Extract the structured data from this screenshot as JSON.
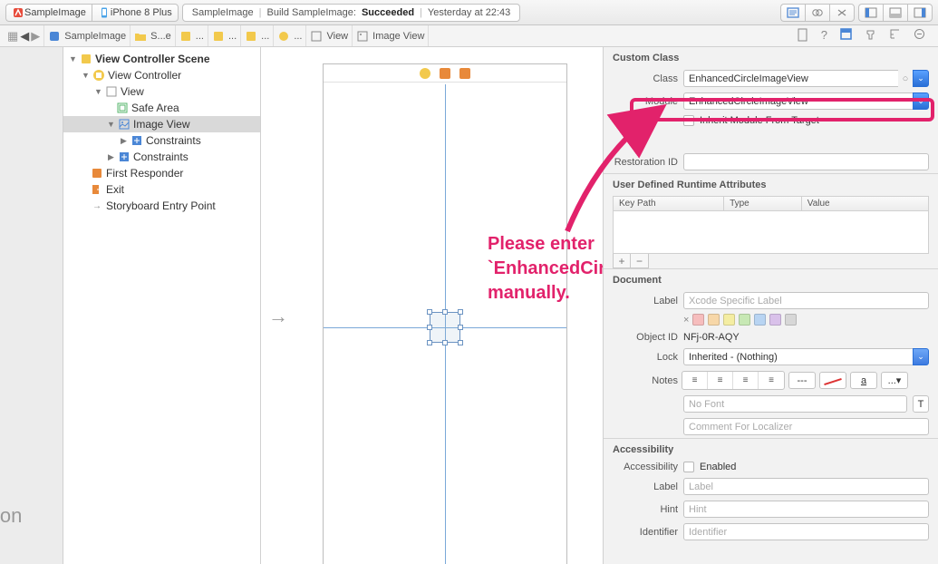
{
  "toolbar": {
    "scheme_project": "SampleImage",
    "scheme_device": "iPhone 8 Plus",
    "status_project": "SampleImage",
    "status_action": "Build SampleImage:",
    "status_result": "Succeeded",
    "status_time": "Yesterday at 22:43"
  },
  "jumpbar": {
    "segs": [
      "SampleImage",
      "S...e",
      "...",
      "...",
      "...",
      "...",
      "View",
      "Image View"
    ]
  },
  "outline": {
    "scene": "View Controller Scene",
    "vc": "View Controller",
    "view": "View",
    "safe": "Safe Area",
    "imgview": "Image View",
    "constraints1": "Constraints",
    "constraints2": "Constraints",
    "first_responder": "First Responder",
    "exit": "Exit",
    "storyboard_entry": "Storyboard Entry Point"
  },
  "annotation": {
    "line1": "Please enter",
    "line2": "`EnhancedCircleImageView`",
    "line3": "manually."
  },
  "inspector": {
    "custom_class": {
      "title": "Custom Class",
      "class_label": "Class",
      "class_value": "EnhancedCircleImageView",
      "module_label": "Module",
      "module_value": "EnhancedCircleImageView",
      "inherit_label": "Inherit Module From Target"
    },
    "identity": {
      "restoration_label": "Restoration ID"
    },
    "udra": {
      "title": "User Defined Runtime Attributes",
      "col_keypath": "Key Path",
      "col_type": "Type",
      "col_value": "Value"
    },
    "document": {
      "title": "Document",
      "label_label": "Label",
      "label_placeholder": "Xcode Specific Label",
      "objectid_label": "Object ID",
      "objectid_value": "NFj-0R-AQY",
      "lock_label": "Lock",
      "lock_value": "Inherited - (Nothing)",
      "notes_label": "Notes",
      "nofont_placeholder": "No Font",
      "comment_placeholder": "Comment For Localizer",
      "swatch_x": "×"
    },
    "accessibility": {
      "title": "Accessibility",
      "acc_label": "Accessibility",
      "enabled_label": "Enabled",
      "label_label": "Label",
      "label_placeholder": "Label",
      "hint_label": "Hint",
      "hint_placeholder": "Hint",
      "identifier_label": "Identifier",
      "identifier_placeholder": "Identifier"
    }
  },
  "left_gutter_text": "sion"
}
